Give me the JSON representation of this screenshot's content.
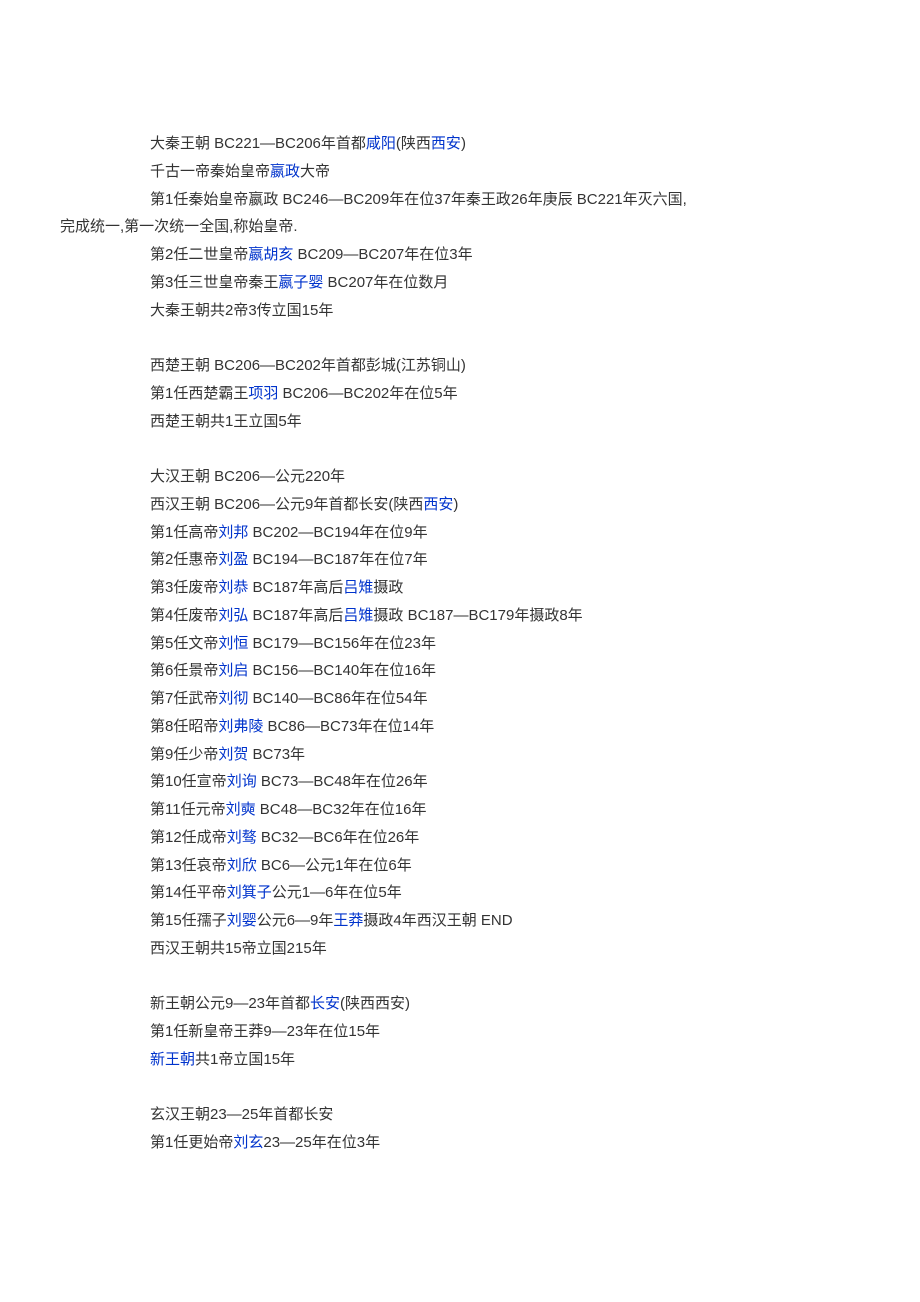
{
  "qin": {
    "header_pre": "大秦王朝 BC221—BC206年首都",
    "header_link1": "咸阳",
    "header_mid": "(陕西",
    "header_link2": "西安",
    "header_post": ")",
    "line2_pre": "千古一帝秦始皇帝",
    "line2_link": "嬴政",
    "line2_post": "大帝",
    "line3a": "第1任秦始皇帝嬴政 BC246—BC209年在位37年秦王政26年庚辰 BC221年灭六国,",
    "line3b": "完成统一,第一次统一全国,称始皇帝.",
    "line4_pre": "第2任二世皇帝",
    "line4_link": "嬴胡亥",
    "line4_post": " BC209—BC207年在位3年",
    "line5_pre": "第3任三世皇帝秦王",
    "line5_link": "嬴子婴",
    "line5_post": " BC207年在位数月",
    "line6": "大秦王朝共2帝3传立国15年"
  },
  "xichu": {
    "line1": "西楚王朝 BC206—BC202年首都彭城(江苏铜山)",
    "line2_pre": "第1任西楚霸王",
    "line2_link": "项羽",
    "line2_post": " BC206—BC202年在位5年",
    "line3": "西楚王朝共1王立国5年"
  },
  "han": {
    "title": "大汉王朝 BC206—公元220年",
    "xihan_pre": "西汉王朝 BC206—公元9年首都长安(陕西",
    "xihan_link": "西安",
    "xihan_post": ")",
    "r1_pre": "第1任高帝",
    "r1_link": "刘邦",
    "r1_post": " BC202—BC194年在位9年",
    "r2_pre": "第2任惠帝",
    "r2_link": "刘盈",
    "r2_post": " BC194—BC187年在位7年",
    "r3_pre": "第3任废帝",
    "r3_link": "刘恭",
    "r3_mid": " BC187年高后",
    "r3_link2": "吕雉",
    "r3_post": "摄政",
    "r4_pre": "第4任废帝",
    "r4_link": "刘弘",
    "r4_mid": " BC187年高后",
    "r4_link2": "吕雉",
    "r4_post": "摄政 BC187—BC179年摄政8年",
    "r5_pre": "第5任文帝",
    "r5_link": "刘恒",
    "r5_post": " BC179—BC156年在位23年",
    "r6_pre": "第6任景帝",
    "r6_link": "刘启",
    "r6_post": " BC156—BC140年在位16年",
    "r7_pre": "第7任武帝",
    "r7_link": "刘彻",
    "r7_post": " BC140—BC86年在位54年",
    "r8_pre": "第8任昭帝",
    "r8_link": "刘弗陵",
    "r8_post": " BC86—BC73年在位14年",
    "r9_pre": "第9任少帝",
    "r9_link": "刘贺",
    "r9_post": " BC73年",
    "r10_pre": "第10任宣帝",
    "r10_link": "刘询",
    "r10_post": " BC73—BC48年在位26年",
    "r11_pre": "第11任元帝",
    "r11_link": "刘奭",
    "r11_post": " BC48—BC32年在位16年",
    "r12_pre": "第12任成帝",
    "r12_link": "刘骜",
    "r12_post": " BC32—BC6年在位26年",
    "r13_pre": "第13任哀帝",
    "r13_link": "刘欣",
    "r13_post": " BC6—公元1年在位6年",
    "r14_pre": "第14任平帝",
    "r14_link": "刘箕子",
    "r14_post": "公元1—6年在位5年",
    "r15_pre": "第15任孺子",
    "r15_link": "刘婴",
    "r15_mid": "公元6—9年",
    "r15_link2": "王莽",
    "r15_post": "摄政4年西汉王朝 END",
    "summary": "西汉王朝共15帝立国215年"
  },
  "xin": {
    "line1_pre": "新王朝公元9—23年首都",
    "line1_link": "长安",
    "line1_post": "(陕西西安)",
    "line2": "第1任新皇帝王莽9—23年在位15年",
    "line3_link": "新王朝",
    "line3_post": "共1帝立国15年"
  },
  "xuanhan": {
    "line1": "玄汉王朝23—25年首都长安",
    "line2_pre": "第1任更始帝",
    "line2_link": "刘玄",
    "line2_post": "23—25年在位3年"
  }
}
